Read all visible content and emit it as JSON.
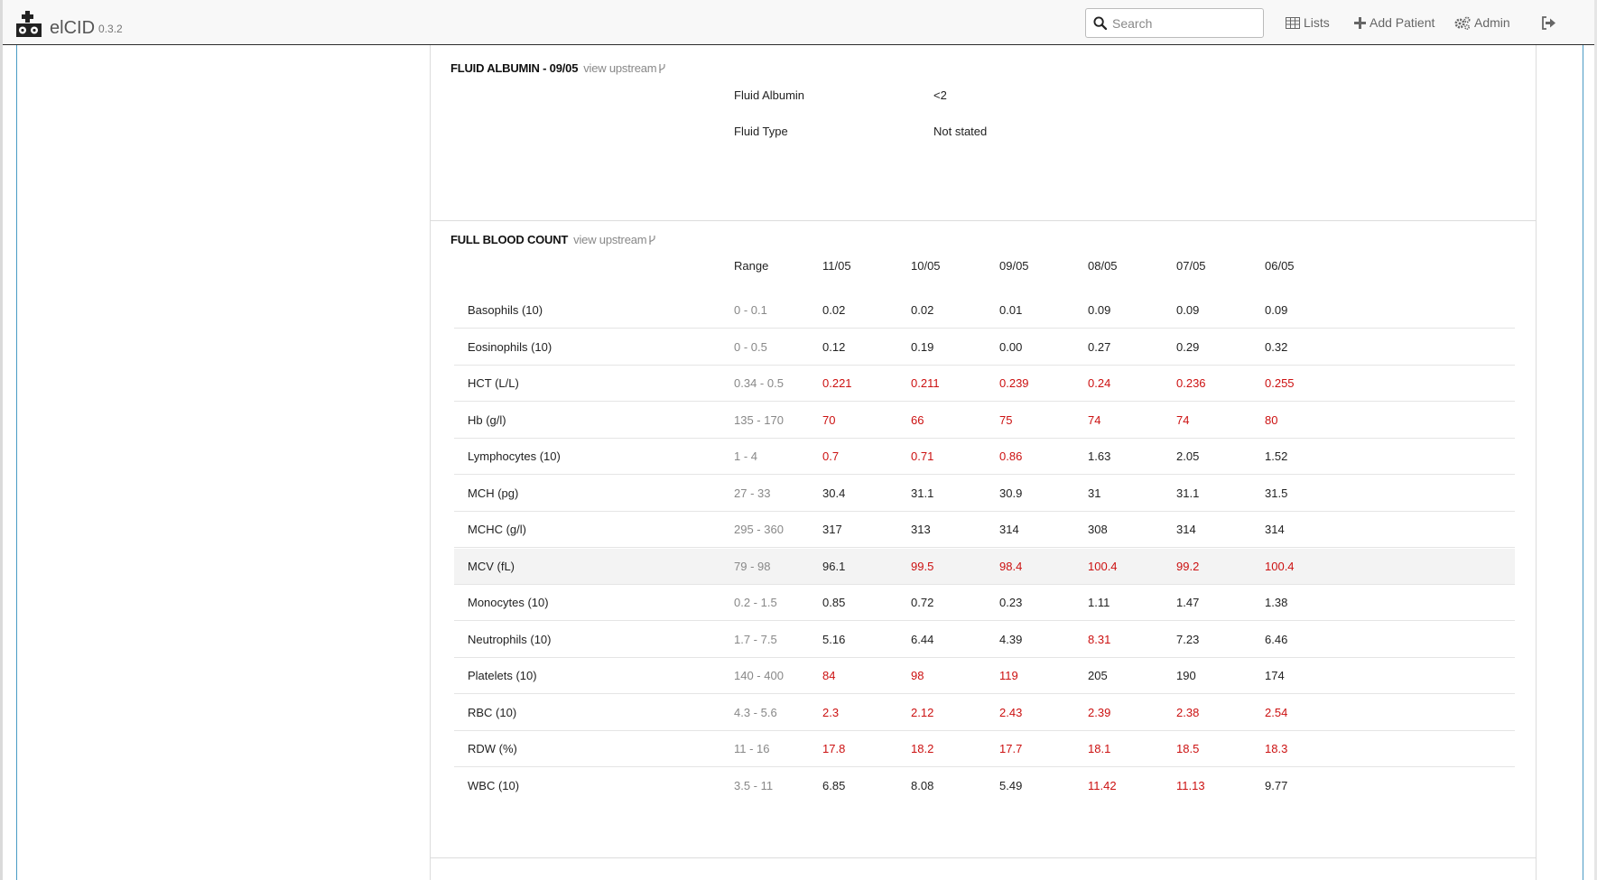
{
  "app": {
    "name": "elCID",
    "version": "0.3.2"
  },
  "navbar": {
    "search_placeholder": "Search",
    "lists_label": "Lists",
    "add_patient_label": "Add Patient",
    "admin_label": "Admin"
  },
  "fluid_albumin": {
    "title": "FLUID ALBUMIN - 09/05",
    "upstream_label": "view upstream",
    "fields": [
      {
        "label": "Fluid Albumin",
        "value": "<2"
      },
      {
        "label": "Fluid Type",
        "value": "Not stated"
      }
    ]
  },
  "full_blood_count": {
    "title": "FULL BLOOD COUNT",
    "upstream_label": "view upstream",
    "range_header": "Range",
    "dates": [
      "11/05",
      "10/05",
      "09/05",
      "08/05",
      "07/05",
      "06/05"
    ],
    "rows": [
      {
        "name": "Basophils (10)",
        "range": "0 - 0.1",
        "values": [
          "0.02",
          "0.02",
          "0.01",
          "0.09",
          "0.09",
          "0.09"
        ],
        "abnormal": [
          false,
          false,
          false,
          false,
          false,
          false
        ]
      },
      {
        "name": "Eosinophils (10)",
        "range": "0 - 0.5",
        "values": [
          "0.12",
          "0.19",
          "0.00",
          "0.27",
          "0.29",
          "0.32"
        ],
        "abnormal": [
          false,
          false,
          false,
          false,
          false,
          false
        ]
      },
      {
        "name": "HCT (L/L)",
        "range": "0.34 - 0.5",
        "values": [
          "0.221",
          "0.211",
          "0.239",
          "0.24",
          "0.236",
          "0.255"
        ],
        "abnormal": [
          true,
          true,
          true,
          true,
          true,
          true
        ]
      },
      {
        "name": "Hb (g/l)",
        "range": "135 - 170",
        "values": [
          "70",
          "66",
          "75",
          "74",
          "74",
          "80"
        ],
        "abnormal": [
          true,
          true,
          true,
          true,
          true,
          true
        ]
      },
      {
        "name": "Lymphocytes (10)",
        "range": "1 - 4",
        "values": [
          "0.7",
          "0.71",
          "0.86",
          "1.63",
          "2.05",
          "1.52"
        ],
        "abnormal": [
          true,
          true,
          true,
          false,
          false,
          false
        ]
      },
      {
        "name": "MCH (pg)",
        "range": "27 - 33",
        "values": [
          "30.4",
          "31.1",
          "30.9",
          "31",
          "31.1",
          "31.5"
        ],
        "abnormal": [
          false,
          false,
          false,
          false,
          false,
          false
        ]
      },
      {
        "name": "MCHC (g/l)",
        "range": "295 - 360",
        "values": [
          "317",
          "313",
          "314",
          "308",
          "314",
          "314"
        ],
        "abnormal": [
          false,
          false,
          false,
          false,
          false,
          false
        ]
      },
      {
        "name": "MCV (fL)",
        "range": "79 - 98",
        "values": [
          "96.1",
          "99.5",
          "98.4",
          "100.4",
          "99.2",
          "100.4"
        ],
        "abnormal": [
          false,
          true,
          true,
          true,
          true,
          true
        ],
        "highlighted": true
      },
      {
        "name": "Monocytes (10)",
        "range": "0.2 - 1.5",
        "values": [
          "0.85",
          "0.72",
          "0.23",
          "1.11",
          "1.47",
          "1.38"
        ],
        "abnormal": [
          false,
          false,
          false,
          false,
          false,
          false
        ]
      },
      {
        "name": "Neutrophils (10)",
        "range": "1.7 - 7.5",
        "values": [
          "5.16",
          "6.44",
          "4.39",
          "8.31",
          "7.23",
          "6.46"
        ],
        "abnormal": [
          false,
          false,
          false,
          true,
          false,
          false
        ]
      },
      {
        "name": "Platelets (10)",
        "range": "140 - 400",
        "values": [
          "84",
          "98",
          "119",
          "205",
          "190",
          "174"
        ],
        "abnormal": [
          true,
          true,
          true,
          false,
          false,
          false
        ]
      },
      {
        "name": "RBC (10)",
        "range": "4.3 - 5.6",
        "values": [
          "2.3",
          "2.12",
          "2.43",
          "2.39",
          "2.38",
          "2.54"
        ],
        "abnormal": [
          true,
          true,
          true,
          true,
          true,
          true
        ]
      },
      {
        "name": "RDW (%)",
        "range": "11 - 16",
        "values": [
          "17.8",
          "18.2",
          "17.7",
          "18.1",
          "18.5",
          "18.3"
        ],
        "abnormal": [
          true,
          true,
          true,
          true,
          true,
          true
        ]
      },
      {
        "name": "WBC (10)",
        "range": "3.5 - 11",
        "values": [
          "6.85",
          "8.08",
          "5.49",
          "11.42",
          "11.13",
          "9.77"
        ],
        "abnormal": [
          false,
          false,
          false,
          true,
          true,
          false
        ]
      }
    ]
  },
  "colors": {
    "abnormal": "#cc1111",
    "range": "#888888",
    "accent_border": "#4a9bc4"
  }
}
